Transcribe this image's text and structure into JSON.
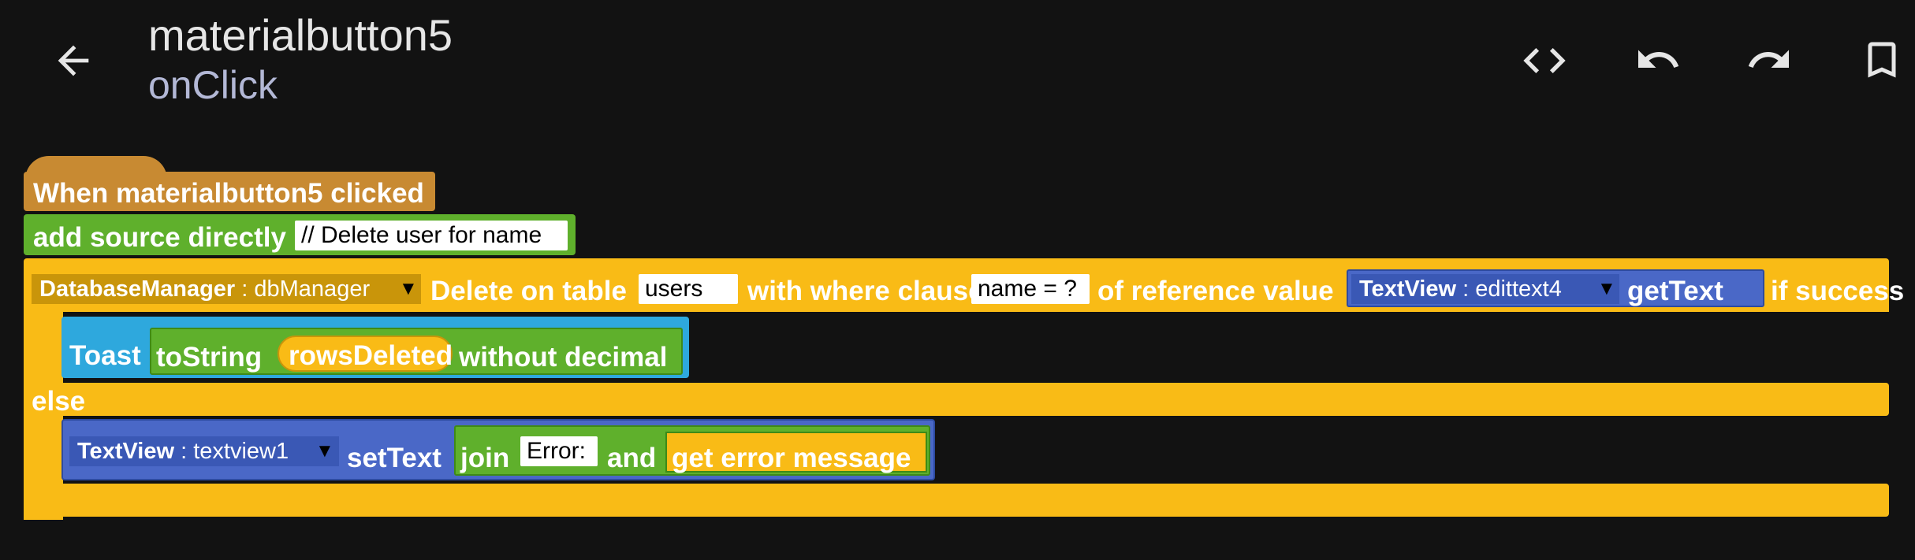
{
  "header": {
    "title": "materialbutton5",
    "subtitle": "onClick",
    "back_icon": "arrow-left-icon",
    "actions": [
      "code-icon",
      "undo-icon",
      "redo-icon",
      "bookmark-icon"
    ]
  },
  "colors": {
    "event": "#c88a32",
    "source": "#5fb02c",
    "logic": "#f9bb16",
    "db_dropdown": "#c9950a",
    "toast": "#2ea8dd",
    "textview": "#4a68c7",
    "string": "#5fb02c"
  },
  "blocks": {
    "event": {
      "label": "When materialbutton5 clicked"
    },
    "source": {
      "label": "add source directly",
      "value": "// Delete user for name"
    },
    "db": {
      "component": "DatabaseManager",
      "component_sep": " : ",
      "instance": "dbManager",
      "delete_label": "Delete on table",
      "table": "users",
      "where_label": "with where clause",
      "where": "name = ?",
      "ref_label": "of reference value",
      "tv_component": "TextView",
      "tv_sep": " : ",
      "tv_instance": "edittext4",
      "get_text": "getText",
      "success_label": "if success",
      "else_label": "else"
    },
    "toast": {
      "label": "Toast",
      "to_string": "toString",
      "param": "rowsDeleted",
      "without": "without decimal"
    },
    "set_text": {
      "component": "TextView",
      "sep": " : ",
      "instance": "textview1",
      "label": "setText",
      "join": "join",
      "join_value": "Error:",
      "and": "and",
      "error": "get error message"
    }
  }
}
